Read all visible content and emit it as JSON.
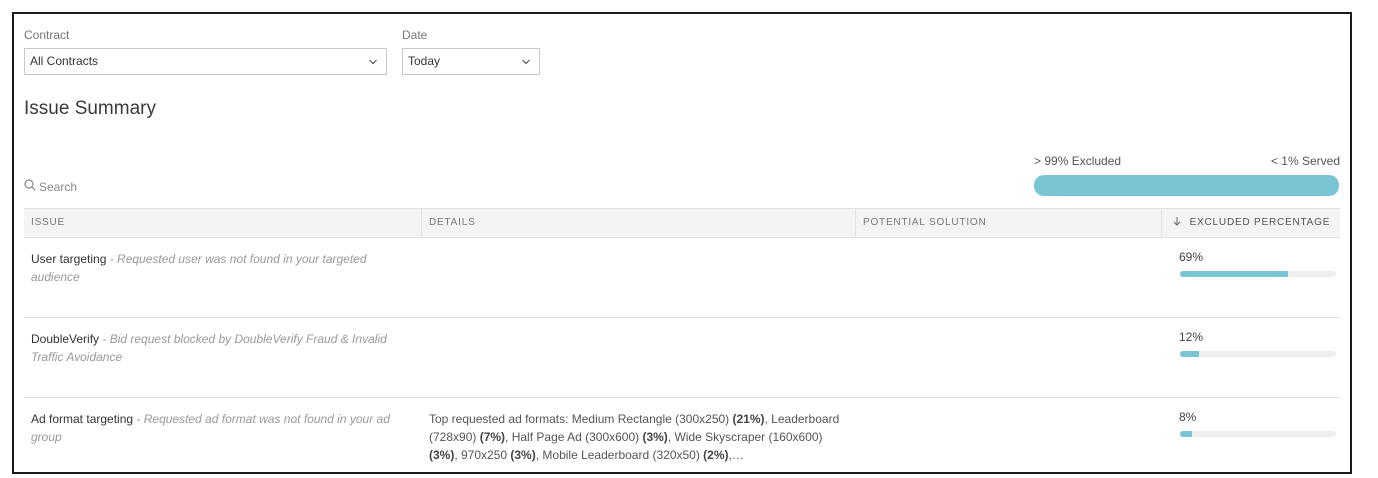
{
  "filters": {
    "contract_label": "Contract",
    "contract_value": "All Contracts",
    "date_label": "Date",
    "date_value": "Today"
  },
  "page_title": "Issue Summary",
  "summary": {
    "excluded_label": "> 99% Excluded",
    "served_label": "< 1% Served",
    "excluded_fraction": 0.99,
    "bar_color": "#7ac5d4"
  },
  "search": {
    "placeholder": "Search"
  },
  "table": {
    "columns": [
      "Issue",
      "Details",
      "Potential Solution",
      "Excluded Percentage"
    ],
    "sort_icon": "arrow-down-icon",
    "rows": [
      {
        "issue_name": "User targeting",
        "issue_desc": " - Requested user was not found in your targeted audience",
        "details": "",
        "solution": "",
        "percent_label": "69%",
        "percent": 69
      },
      {
        "issue_name": "DoubleVerify",
        "issue_desc": " - Bid request blocked by DoubleVerify Fraud & Invalid Traffic Avoidance",
        "details": "",
        "solution": "",
        "percent_label": "12%",
        "percent": 12
      },
      {
        "issue_name": "Ad format targeting",
        "issue_desc": " - Requested ad format was not found in your ad group",
        "details_parts": [
          {
            "text": "Top requested ad formats: Medium Rectangle (300x250) ",
            "bold": false
          },
          {
            "text": "(21%)",
            "bold": true
          },
          {
            "text": ", Leaderboard (728x90) ",
            "bold": false
          },
          {
            "text": "(7%)",
            "bold": true
          },
          {
            "text": ", Half Page Ad (300x600) ",
            "bold": false
          },
          {
            "text": "(3%)",
            "bold": true
          },
          {
            "text": ", Wide Skyscraper (160x600) ",
            "bold": false
          },
          {
            "text": "(3%)",
            "bold": true
          },
          {
            "text": ", 970x250 ",
            "bold": false
          },
          {
            "text": "(3%)",
            "bold": true
          },
          {
            "text": ", Mobile Leaderboard (320x50) ",
            "bold": false
          },
          {
            "text": "(2%)",
            "bold": true
          },
          {
            "text": ",…",
            "bold": false
          }
        ],
        "solution": "",
        "percent_label": "8%",
        "percent": 8
      }
    ]
  }
}
